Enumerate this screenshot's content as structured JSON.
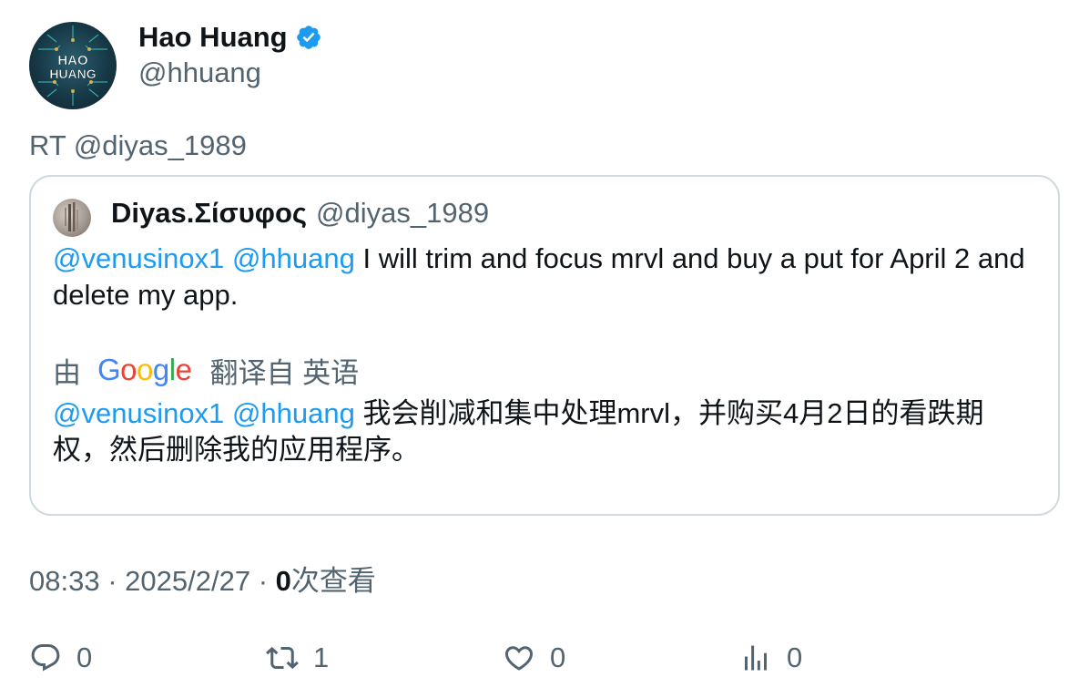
{
  "author": {
    "display_name": "Hao Huang",
    "handle": "@hhuang",
    "avatar_text": "HAO HUANG"
  },
  "retweet_label": "RT @diyas_1989",
  "quote": {
    "display_name": "Diyas.Σίσυφος",
    "handle": "@diyas_1989",
    "mention1": "@venusinox1",
    "mention2": "@hhuang",
    "text": "I will trim and focus mrvl and buy a put for April 2 and delete my app.",
    "translation_prefix": "由",
    "translation_provider": "Google",
    "translation_suffix": "翻译自 英语",
    "translated_text": "我会削减和集中处理mrvl，并购买4月2日的看跌期权，然后删除我的应用程序。"
  },
  "meta": {
    "time": "08:33",
    "date": "2025/2/27",
    "views_count": "0",
    "views_label": "次查看",
    "separator": "·"
  },
  "actions": {
    "replies": "0",
    "retweets": "1",
    "likes": "0",
    "views": "0"
  },
  "colors": {
    "accent": "#1d9bf0",
    "text_secondary": "#536471",
    "border": "#cfd9de"
  }
}
